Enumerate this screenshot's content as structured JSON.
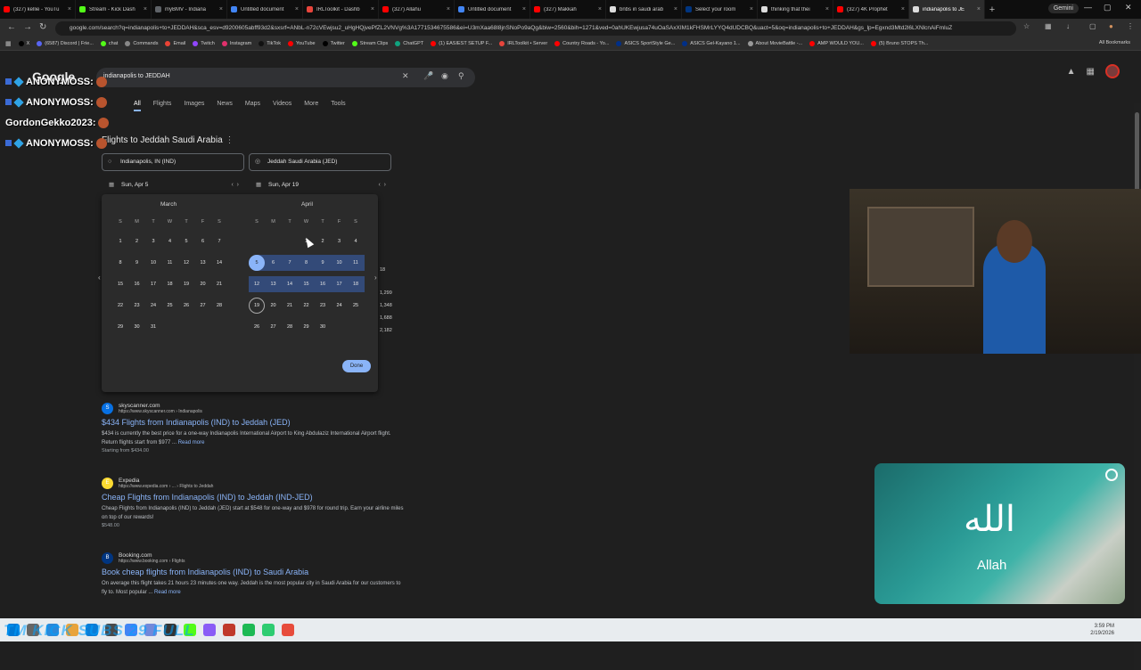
{
  "browser": {
    "tabs": [
      {
        "label": "(327) kellie - YouTu",
        "color": "#ff0000"
      },
      {
        "label": "Stream - Kick Dash",
        "color": "#53fc18"
      },
      {
        "label": "myBMV - Indiana",
        "color": "#5f6368"
      },
      {
        "label": "Untitled document",
        "color": "#4285f4"
      },
      {
        "label": "IRLToolkit - Dashb",
        "color": "#e8453c"
      },
      {
        "label": "(327) Allahu",
        "color": "#ff0000"
      },
      {
        "label": "Untitled document",
        "color": "#4285f4"
      },
      {
        "label": "(327) Makkah",
        "color": "#ff0000"
      },
      {
        "label": "bnbs in saudi arab",
        "color": "#dcdcdc"
      },
      {
        "label": "Select your room",
        "color": "#003580"
      },
      {
        "label": "thinking that thei",
        "color": "#dcdcdc"
      },
      {
        "label": "(327) 4K Prophet",
        "color": "#ff0000"
      },
      {
        "label": "indianapolis to JE",
        "color": "#dcdcdc",
        "active": true
      }
    ],
    "new_tab": "+",
    "gemini": "Gemini",
    "url": "google.com/search?q=indianapolis+to+JEDDAH&sca_esv=d9200605abff93d2&sxsrf=ANbL-n72cVEwjsu2_uHgHQjvePfZL2VNVg%3A1771534675586&ei=U3mXaa68l8jnSNoPo9aQg&biw=2560&bih=1271&ved=0ahUKEwjusa74uOaSAxXIM1kFHSMrLYYQ4dUDCBQ&uact=5&oq=indianapolis+to+JEDDAH&gs_lp=Egxnd3Mtd2l6LXNlcnAiFmluZ",
    "bookmarks": [
      {
        "label": "X",
        "color": "#000000"
      },
      {
        "label": "(6587) Discord | Frie...",
        "color": "#5865f2"
      },
      {
        "label": "chat",
        "color": "#53fc18"
      },
      {
        "label": "Commands",
        "color": "#888888"
      },
      {
        "label": "Email",
        "color": "#ea4335"
      },
      {
        "label": "Twitch",
        "color": "#9146ff"
      },
      {
        "label": "Instagram",
        "color": "#e1306c"
      },
      {
        "label": "TikTok",
        "color": "#111111"
      },
      {
        "label": "YouTube",
        "color": "#ff0000"
      },
      {
        "label": "Twitter",
        "color": "#000000"
      },
      {
        "label": "Stream Clips",
        "color": "#53fc18"
      },
      {
        "label": "ChatGPT",
        "color": "#10a37f"
      },
      {
        "label": "(1) EASIEST SETUP F...",
        "color": "#ff0000"
      },
      {
        "label": "IRLToolkit • Server",
        "color": "#e8453c"
      },
      {
        "label": "Country Roads - Yo...",
        "color": "#ff0000"
      },
      {
        "label": "ASICS SportStyle Ge...",
        "color": "#002f87"
      },
      {
        "label": "ASICS Gel-Kayano 1...",
        "color": "#002f87"
      },
      {
        "label": "About MovieBattle -...",
        "color": "#999999"
      },
      {
        "label": "AMP WOULD YOU...",
        "color": "#ff0000"
      },
      {
        "label": "(5) Bruno STOPS Th...",
        "color": "#ff0000"
      }
    ],
    "all_bookmarks": "All Bookmarks"
  },
  "google": {
    "logo": "Google",
    "query": "indianapolis to JEDDAH",
    "nav_tabs": [
      "All",
      "Flights",
      "Images",
      "News",
      "Maps",
      "Videos",
      "More",
      "Tools"
    ],
    "active_tab": "All"
  },
  "flights": {
    "title": "Flights to Jeddah Saudi Arabia",
    "origin": "Indianapolis, IN (IND)",
    "destination": "Jeddah Saudi Arabia (JED)",
    "depart_date": "Sun, Apr 5",
    "return_date": "Sun, Apr 19",
    "months": [
      "March",
      "April"
    ],
    "weekdays": [
      "S",
      "M",
      "T",
      "W",
      "T",
      "F",
      "S"
    ],
    "march_days": [
      "1",
      "2",
      "3",
      "4",
      "5",
      "6",
      "7",
      "8",
      "9",
      "10",
      "11",
      "12",
      "13",
      "14",
      "15",
      "16",
      "17",
      "18",
      "19",
      "20",
      "21",
      "22",
      "23",
      "24",
      "25",
      "26",
      "27",
      "28",
      "29",
      "30",
      "31"
    ],
    "april_days": [
      "1",
      "2",
      "3",
      "4",
      "5",
      "6",
      "7",
      "8",
      "9",
      "10",
      "11",
      "12",
      "13",
      "14",
      "15",
      "16",
      "17",
      "18",
      "19",
      "20",
      "21",
      "22",
      "23",
      "24",
      "25",
      "26",
      "27",
      "28",
      "29",
      "30"
    ],
    "done": "Done",
    "peek_prices": [
      "18",
      "1,299",
      "1,348",
      "1,688",
      "2,182"
    ]
  },
  "results": [
    {
      "source": "skyscanner.com",
      "url": "https://www.skyscanner.com › Indianapolis",
      "title": "$434 Flights from Indianapolis (IND) to Jeddah (JED)",
      "snippet": "$434 is currently the best price for a one-way Indianapolis International Airport to King Abdulaziz International Airport flight. Return flights start from $977 ...",
      "more": "Read more",
      "extra": "Starting from $434.00",
      "fav_color": "#0770e3",
      "fav_letter": "S"
    },
    {
      "source": "Expedia",
      "url": "https://www.expedia.com › ... › Flights to Jeddah",
      "title": "Cheap Flights from Indianapolis (IND) to Jeddah (IND-JED)",
      "snippet": "Cheap Flights from Indianapolis (IND) to Jeddah (JED) start at $548 for one-way and $978 for round trip. Earn your airline miles on top of our rewards!",
      "more": "",
      "extra": "$548.00",
      "fav_color": "#fddb32",
      "fav_letter": "E"
    },
    {
      "source": "Booking.com",
      "url": "https://www.booking.com › Flights",
      "title": "Book cheap flights from Indianapolis (IND) to Saudi Arabia",
      "snippet": "On average this flight takes 21 hours 23 minutes one way. Jeddah is the most popular city in Saudi Arabia for our customers to fly to. Most popular ...",
      "more": "Read more",
      "extra": "",
      "fav_color": "#003580",
      "fav_letter": "B"
    }
  ],
  "overlay": {
    "chat": [
      {
        "user": "ANONYMOSS:",
        "kind": "cube"
      },
      {
        "user": "ANONYMOSS:",
        "kind": "cube"
      },
      {
        "user": "GordonGekko2023:",
        "kind": "plain"
      },
      {
        "user": "ANONYMOSS:",
        "kind": "cube"
      }
    ],
    "video_label": "Allah",
    "video_arabic": "الله",
    "ticker": "TM KICK SUBS 29 FULL"
  },
  "taskbar": {
    "time": "3:59 PM",
    "date": "2/19/2026"
  }
}
